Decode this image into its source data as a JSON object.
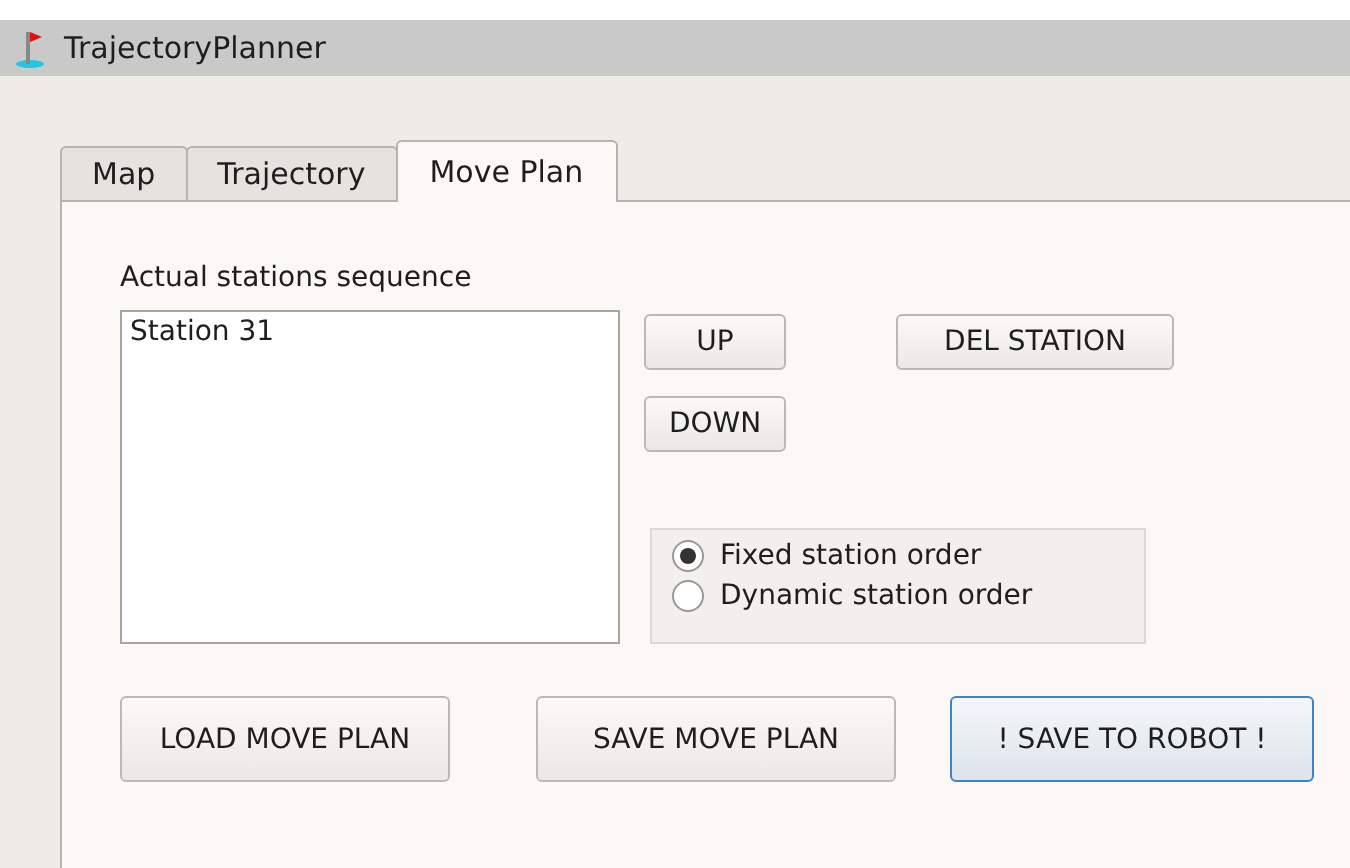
{
  "window": {
    "title": "TrajectoryPlanner"
  },
  "tabs": [
    {
      "label": "Map",
      "selected": false
    },
    {
      "label": "Trajectory",
      "selected": false
    },
    {
      "label": "Move Plan",
      "selected": true
    }
  ],
  "sequence": {
    "label": "Actual stations sequence",
    "items": [
      "Station 31"
    ]
  },
  "move_buttons": [
    "UP",
    "DOWN"
  ],
  "del_button": "DEL STATION",
  "order_options": [
    {
      "label": "Fixed station order",
      "selected": true
    },
    {
      "label": "Dynamic station order",
      "selected": false
    }
  ],
  "bottom_buttons": [
    {
      "label": "LOAD MOVE PLAN",
      "focused": false
    },
    {
      "label": "SAVE MOVE PLAN",
      "focused": false
    },
    {
      "label": "! SAVE TO ROBOT !",
      "focused": true
    }
  ]
}
